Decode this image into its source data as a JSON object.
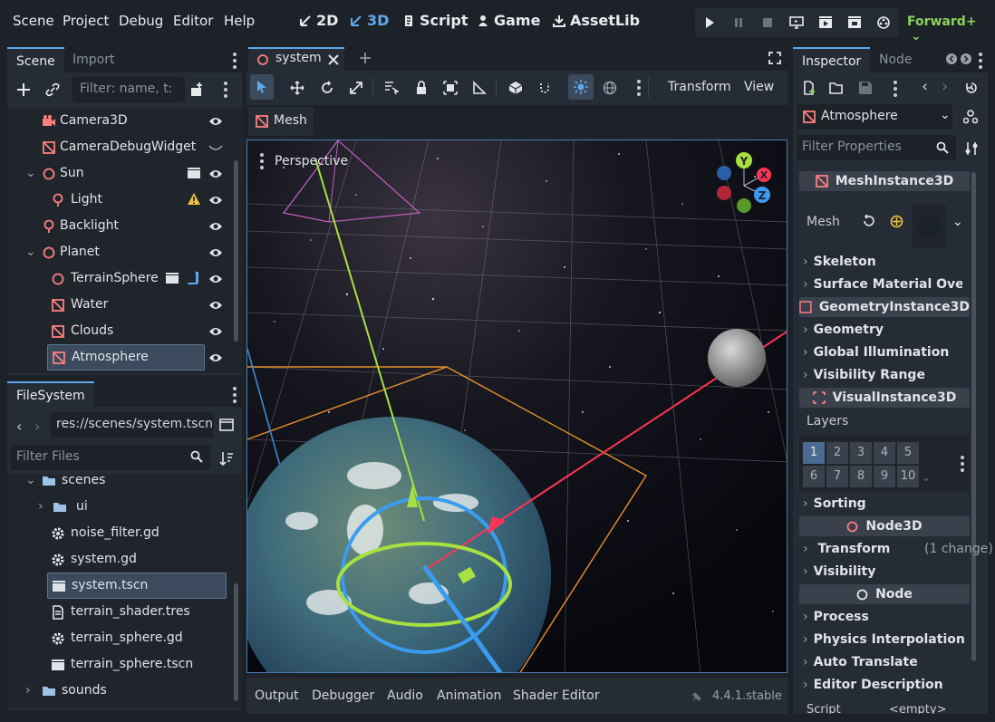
{
  "menu": [
    "Scene",
    "Project",
    "Debug",
    "Editor",
    "Help"
  ],
  "workspaces": [
    {
      "label": "2D",
      "icon": "2d-icon",
      "active": false
    },
    {
      "label": "3D",
      "icon": "3d-icon",
      "active": true
    },
    {
      "label": "Script",
      "icon": "script-icon",
      "active": false
    },
    {
      "label": "Game",
      "icon": "game-icon",
      "active": false
    },
    {
      "label": "AssetLib",
      "icon": "assetlib-icon",
      "active": false
    }
  ],
  "renderer": "Forward+",
  "scene_dock": {
    "tabs": [
      "Scene",
      "Import"
    ],
    "filter_placeholder": "Filter: name, t:",
    "nodes": [
      {
        "label": "Camera3D",
        "icon": "camera-icon"
      },
      {
        "label": "CameraDebugWidget",
        "icon": "mesh-instance-icon"
      },
      {
        "label": "Sun",
        "icon": "node3d-icon"
      },
      {
        "label": "Light",
        "icon": "light-icon"
      },
      {
        "label": "Backlight",
        "icon": "light-icon"
      },
      {
        "label": "Planet",
        "icon": "node3d-icon"
      },
      {
        "label": "TerrainSphere",
        "icon": "node3d-icon"
      },
      {
        "label": "Water",
        "icon": "mesh-instance-icon"
      },
      {
        "label": "Clouds",
        "icon": "mesh-instance-icon"
      },
      {
        "label": "Atmosphere",
        "icon": "mesh-instance-icon",
        "selected": true
      }
    ]
  },
  "filesystem": {
    "tab": "FileSystem",
    "path": "res://scenes/system.tscn",
    "filter_placeholder": "Filter Files",
    "items": [
      {
        "label": "scenes",
        "icon": "folder-icon"
      },
      {
        "label": "ui",
        "icon": "folder-icon"
      },
      {
        "label": "noise_filter.gd",
        "icon": "gear-icon"
      },
      {
        "label": "system.gd",
        "icon": "gear-icon"
      },
      {
        "label": "system.tscn",
        "icon": "clapper-icon",
        "selected": true
      },
      {
        "label": "terrain_shader.tres",
        "icon": "resource-icon"
      },
      {
        "label": "terrain_sphere.gd",
        "icon": "gear-icon"
      },
      {
        "label": "terrain_sphere.tscn",
        "icon": "clapper-icon"
      },
      {
        "label": "sounds",
        "icon": "folder-icon"
      }
    ]
  },
  "editor": {
    "scene_tab": "system",
    "toolbar": {
      "transform": "Transform",
      "view": "View"
    },
    "mesh_button": "Mesh",
    "perspective": "Perspective"
  },
  "gizmo_axes": [
    "Y",
    "X",
    "Z"
  ],
  "bottom_tabs": [
    "Output",
    "Debugger",
    "Audio",
    "Animation",
    "Shader Editor"
  ],
  "version": "4.4.1.stable",
  "inspector": {
    "tabs": [
      "Inspector",
      "Node"
    ],
    "object": "Atmosphere",
    "filter_placeholder": "Filter Properties",
    "sections": {
      "mesh_instance": "MeshInstance3D",
      "geometry_instance": "GeometryInstance3D",
      "visual_instance": "VisualInstance3D",
      "node3d": "Node3D",
      "node": "Node"
    },
    "mesh_label": "Mesh",
    "layers_label": "Layers",
    "layers": [
      "1",
      "2",
      "3",
      "4",
      "5",
      "6",
      "7",
      "8",
      "9",
      "10"
    ],
    "categories_a": [
      "Skeleton",
      "Surface Material Overri"
    ],
    "categories_b": [
      "Geometry",
      "Global Illumination",
      "Visibility Range"
    ],
    "categories_c": [
      "Sorting"
    ],
    "transform": "Transform",
    "transform_change": "(1 change)",
    "visibility": "Visibility",
    "categories_d": [
      "Process",
      "Physics Interpolation",
      "Auto Translate",
      "Editor Description"
    ],
    "script_label": "Script",
    "script_value": "<empty>"
  },
  "colors": {
    "accent": "#5fa8ee",
    "renderer": "#8ad05a",
    "node3d": "#fc7f7f",
    "warning": "#f0c040"
  }
}
